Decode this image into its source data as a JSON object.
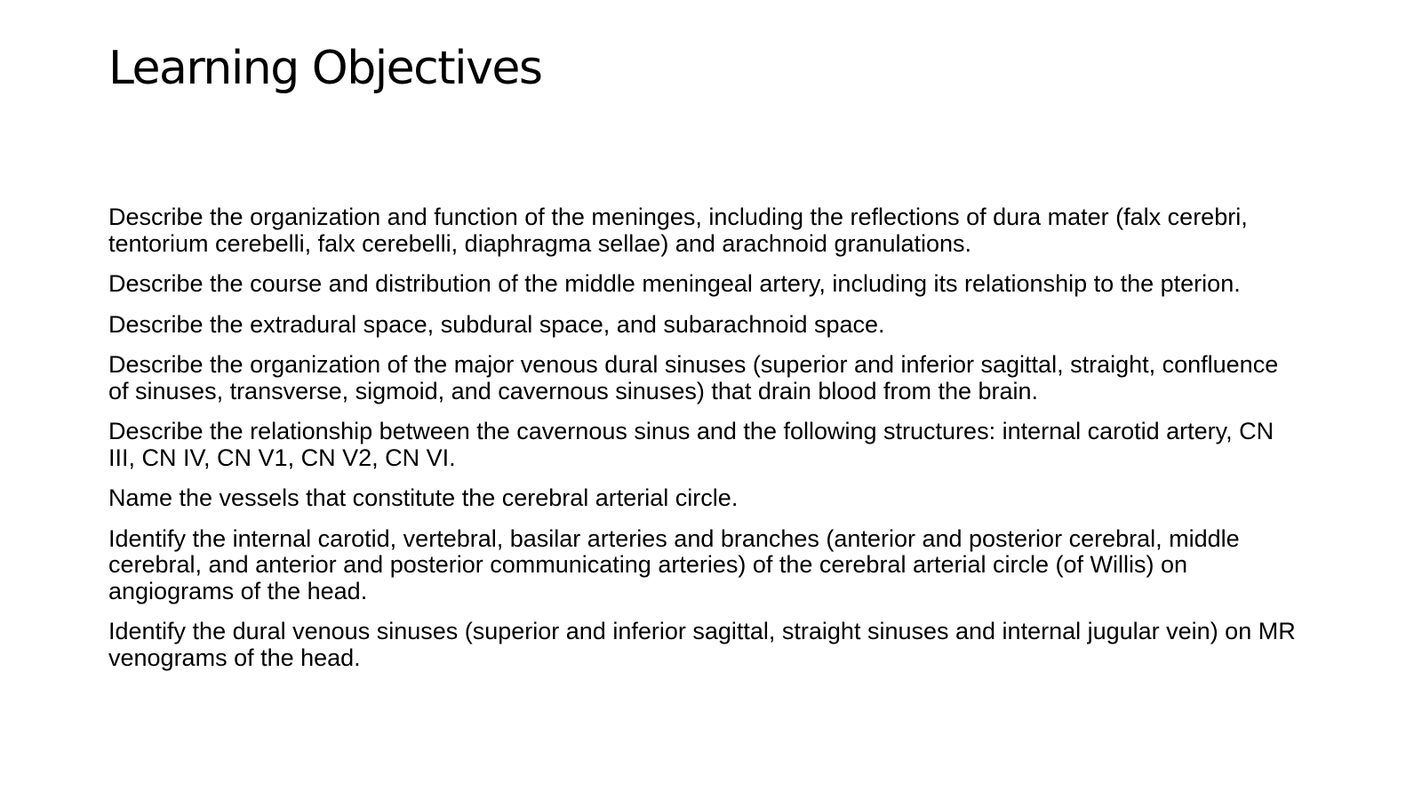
{
  "slide": {
    "title": "Learning Objectives",
    "objectives": [
      "Describe the organization and function of the meninges, including the reflections of dura mater (falx cerebri, tentorium cerebelli, falx cerebelli, diaphragma sellae) and arachnoid granulations.",
      "Describe the course and distribution of the middle meningeal artery, including its relationship to the pterion.",
      "Describe the extradural space, subdural space, and subarachnoid space.",
      "Describe the organization of the major venous dural sinuses (superior and inferior sagittal, straight, confluence of sinuses, transverse, sigmoid, and cavernous sinuses)  that drain blood from the brain.",
      "Describe the relationship between the cavernous sinus and the following structures: internal carotid artery, CN III, CN IV, CN V1, CN V2, CN VI.",
      "Name the vessels that constitute the cerebral arterial circle.",
      "Identify the internal carotid, vertebral, basilar arteries and branches (anterior and posterior cerebral, middle cerebral, and anterior and posterior communicating arteries) of the cerebral arterial circle (of Willis) on angiograms of the head.",
      "Identify the dural venous sinuses (superior and inferior sagittal, straight sinuses and internal jugular vein) on MR venograms of the head."
    ]
  }
}
